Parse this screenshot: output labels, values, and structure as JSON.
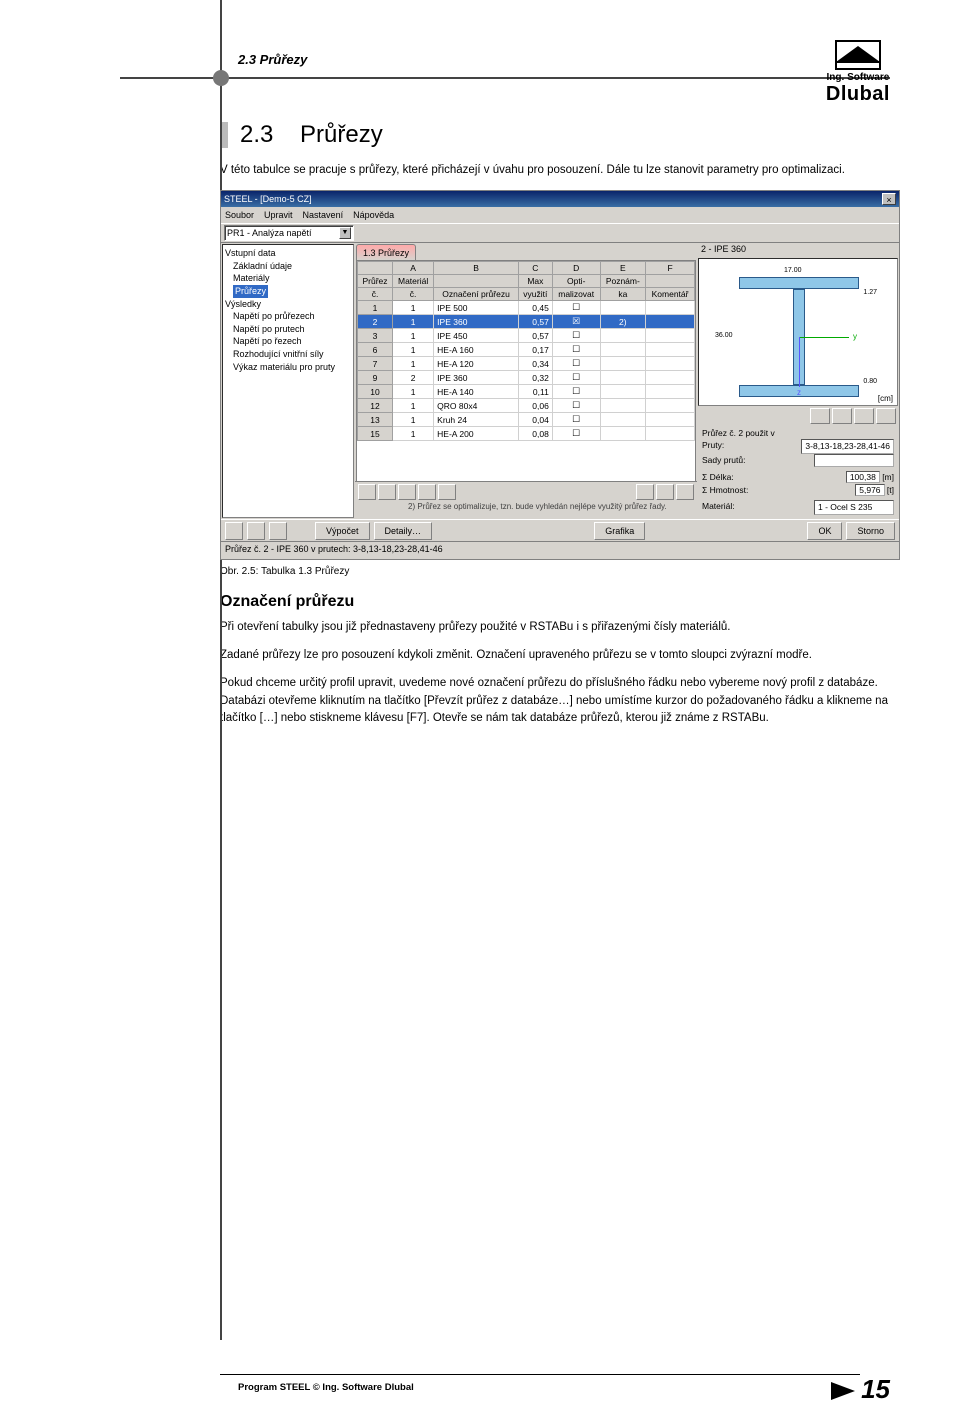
{
  "runhead": "2.3 Průřezy",
  "brand": {
    "line1": "Ing. Software",
    "line2": "Dlubal"
  },
  "section": {
    "num": "2.3",
    "title": "Průřezy"
  },
  "intro": "V této tabulce se pracuje s průřezy, které přicházejí v úvahu pro posouzení. Dále tu lze stanovit parametry pro optimalizaci.",
  "caption": "Obr. 2.5: Tabulka 1.3 Průřezy",
  "sub_heading": "Označení průřezu",
  "p1": "Při otevření tabulky jsou již přednastaveny průřezy použité v RSTABu i s přiřazenými čísly materiálů.",
  "p2": "Zadané průřezy lze pro posouzení kdykoli změnit. Označení upraveného průřezu se v tomto sloupci zvýrazní modře.",
  "p3": "Pokud chceme určitý profil upravit, uvedeme nové označení průřezu do příslušného řádku nebo vybereme nový profil z databáze. Databázi otevřeme kliknutím na tlačítko [Převzít průřez z databáze…] nebo umístíme kurzor do požadovaného řádku a klikneme na tlačítko […] nebo stiskneme klávesu [F7]. Otevře se nám tak databáze průřezů, kterou již známe z RSTABu.",
  "footer": {
    "left": "Program STEEL © Ing. Software Dlubal",
    "page": "15"
  },
  "shot": {
    "title": "STEEL - [Demo-5 CZ]",
    "menus": [
      "Soubor",
      "Upravit",
      "Nastavení",
      "Nápověda"
    ],
    "combo": "PR1 - Analýza napětí",
    "nav": {
      "groups": [
        {
          "label": "Vstupní data",
          "items": [
            "Základní údaje",
            "Materiály",
            "Průřezy"
          ]
        },
        {
          "label": "Výsledky",
          "items": [
            "Napětí po průřezech",
            "Napětí po prutech",
            "Napětí po řezech",
            "Rozhodující vnitřní síly",
            "Výkaz materiálu pro pruty"
          ]
        }
      ],
      "selected": "Průřezy"
    },
    "tab_label": "1.3 Průřezy",
    "cols": {
      "letters": [
        "A",
        "B",
        "C",
        "D",
        "E",
        "F"
      ],
      "h1": [
        "Průřez",
        "Materiál",
        "",
        "Max",
        "Opti-",
        "Poznám-",
        ""
      ],
      "h2": [
        "č.",
        "č.",
        "Označení průřezu",
        "využití",
        "malizovat",
        "ka",
        "Komentář"
      ]
    },
    "rows": [
      {
        "n": "1",
        "mat": "1",
        "name": "IPE 500",
        "util": "0,45",
        "opt": "",
        "note": ""
      },
      {
        "n": "2",
        "mat": "1",
        "name": "IPE 360",
        "util": "0,57",
        "opt": "x",
        "note": "2)",
        "sel": true
      },
      {
        "n": "3",
        "mat": "1",
        "name": "IPE 450",
        "util": "0,57",
        "opt": "",
        "note": ""
      },
      {
        "n": "6",
        "mat": "1",
        "name": "HE-A 160",
        "util": "0,17",
        "opt": "",
        "note": ""
      },
      {
        "n": "7",
        "mat": "1",
        "name": "HE-A 120",
        "util": "0,34",
        "opt": "",
        "note": ""
      },
      {
        "n": "9",
        "mat": "2",
        "name": "IPE 360",
        "util": "0,32",
        "opt": "",
        "note": ""
      },
      {
        "n": "10",
        "mat": "1",
        "name": "HE-A 140",
        "util": "0,11",
        "opt": "",
        "note": ""
      },
      {
        "n": "12",
        "mat": "1",
        "name": "QRO 80x4",
        "util": "0,06",
        "opt": "",
        "note": ""
      },
      {
        "n": "13",
        "mat": "1",
        "name": "Kruh 24",
        "util": "0,04",
        "opt": "",
        "note": ""
      },
      {
        "n": "15",
        "mat": "1",
        "name": "HE-A 200",
        "util": "0,08",
        "opt": "",
        "note": ""
      }
    ],
    "mid_footnote": "2) Průřez se optimalizuje, tzn. bude vyhledán nejlépe využitý průřez řady.",
    "right": {
      "title": "2 - IPE 360",
      "dim_w": "17.00",
      "dim_h": "36.00",
      "dim_t": "1.27",
      "dim_tf": "0.80",
      "unit": "[cm]",
      "info_header": "Průřez č. 2 použit v",
      "pruty_label": "Pruty:",
      "pruty_val": "3-8,13-18,23-28,41-46",
      "sady_label": "Sady prutů:",
      "delka_label": "Σ Délka:",
      "delka_val": "100,38",
      "delka_unit": "[m]",
      "hmot_label": "Σ Hmotnost:",
      "hmot_val": "5,976",
      "hmot_unit": "[t]",
      "material_label": "Materiál:",
      "material_val": "1 - Ocel S 235"
    },
    "buttons": {
      "vypocet": "Výpočet",
      "detaily": "Detaily…",
      "grafika": "Grafika",
      "ok": "OK",
      "storno": "Storno"
    },
    "status": "Průřez č. 2 - IPE 360 v prutech: 3-8,13-18,23-28,41-46"
  }
}
